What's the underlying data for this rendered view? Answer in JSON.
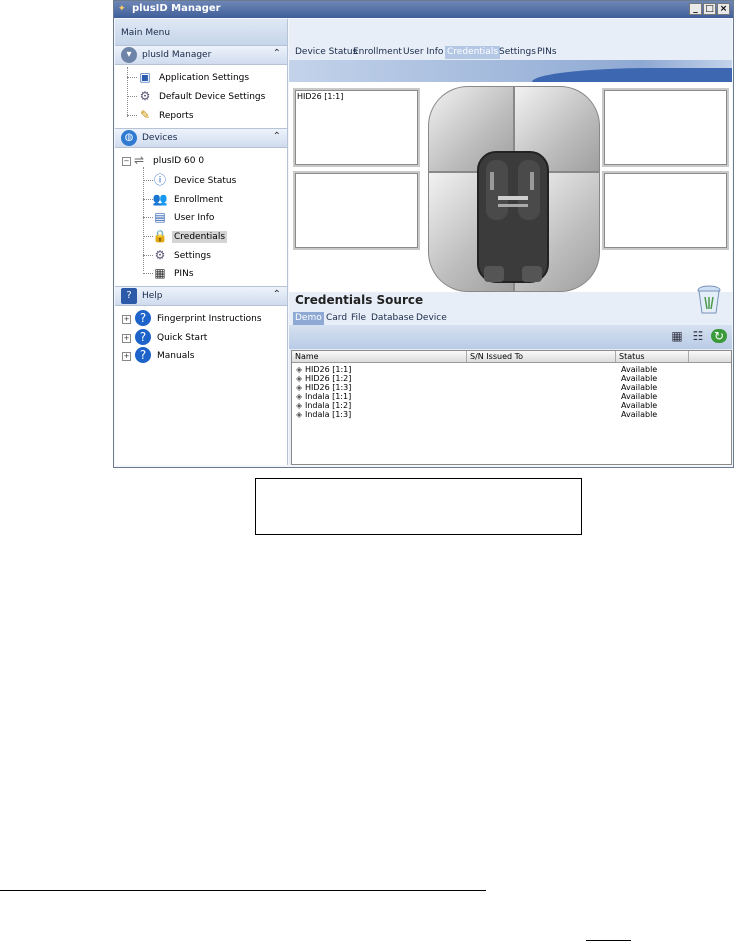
{
  "window": {
    "title": "plusID Manager",
    "buttons": [
      "_",
      "□",
      "×"
    ]
  },
  "left": {
    "main_menu": "Main Menu",
    "sections": {
      "manager": {
        "label": "plusId Manager",
        "icon": "manager-icon",
        "items": [
          {
            "label": "Application Settings",
            "icon": "monitor-icon"
          },
          {
            "label": "Default Device Settings",
            "icon": "gear-icon"
          },
          {
            "label": "Reports",
            "icon": "report-icon"
          }
        ]
      },
      "devices": {
        "label": "Devices",
        "icon": "globe-icon",
        "device": {
          "label": "plusID 60 0",
          "icon": "usb-icon"
        },
        "items": [
          {
            "label": "Device Status",
            "icon": "info-icon"
          },
          {
            "label": "Enrollment",
            "icon": "users-icon"
          },
          {
            "label": "User Info",
            "icon": "user-card-icon"
          },
          {
            "label": "Credentials",
            "icon": "lock-icon",
            "selected": true
          },
          {
            "label": "Settings",
            "icon": "gear-icon"
          },
          {
            "label": "PINs",
            "icon": "keypad-icon"
          }
        ]
      },
      "help": {
        "label": "Help",
        "icon": "help-icon",
        "items": [
          {
            "label": "Fingerprint Instructions",
            "icon": "help-icon"
          },
          {
            "label": "Quick Start",
            "icon": "help-icon"
          },
          {
            "label": "Manuals",
            "icon": "help-icon"
          }
        ]
      }
    }
  },
  "tabs": [
    "Device Status",
    "Enrollment",
    "User Info",
    "Credentials",
    "Settings",
    "PINs"
  ],
  "active_tab": "Credentials",
  "slots": [
    "HID26 [1:1]",
    "",
    "",
    ""
  ],
  "credentials_source": {
    "title": "Credentials Source",
    "subtabs": [
      "Demo",
      "Card",
      "File",
      "Database",
      "Device"
    ],
    "active_subtab": "Demo",
    "toolbar_icons": [
      "grid-view-icon",
      "list-view-icon",
      "refresh-icon"
    ]
  },
  "table": {
    "columns": [
      "Name",
      "S/N Issued To",
      "Status"
    ],
    "rows": [
      {
        "name": "HID26 [1:1]",
        "sn": "",
        "status": "Available"
      },
      {
        "name": "HID26 [1:2]",
        "sn": "",
        "status": "Available"
      },
      {
        "name": "HID26 [1:3]",
        "sn": "",
        "status": "Available"
      },
      {
        "name": "Indala [1:1]",
        "sn": "",
        "status": "Available"
      },
      {
        "name": "Indala [1:2]",
        "sn": "",
        "status": "Available"
      },
      {
        "name": "Indala [1:3]",
        "sn": "",
        "status": "Available"
      }
    ]
  },
  "colors": {
    "accent": "#3d67b0",
    "tab_active": "#b4c8e6"
  }
}
